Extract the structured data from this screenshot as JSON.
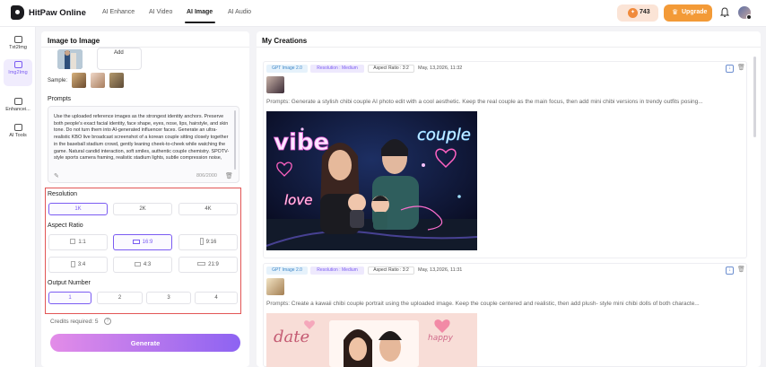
{
  "app": {
    "name": "HitPaw Online"
  },
  "nav": {
    "items": [
      "AI Enhance",
      "AI Video",
      "AI Image",
      "AI Audio"
    ],
    "active": "AI Image"
  },
  "header": {
    "credits": "743",
    "upgrade_label": "Upgrade"
  },
  "sidebar": {
    "items": [
      {
        "label": "Txt2Img",
        "icon": "text-image-icon"
      },
      {
        "label": "Img2Img",
        "icon": "image-image-icon",
        "active": true
      },
      {
        "label": "Enhancei...",
        "icon": "enhance-icon"
      },
      {
        "label": "AI Tools",
        "icon": "tools-icon"
      }
    ]
  },
  "left_panel": {
    "title": "Image to Image",
    "add_label": "Add",
    "sample_label": "Sample:",
    "prompts_label": "Prompts",
    "prompt_text": "Use the uploaded reference images as the strongest identity anchors. Preserve both people's exact facial identity, face shape, eyes, nose, lips, hairstyle, and skin tone. Do not turn them into AI-generated influencer faces. Generate an ultra-realistic KBO live broadcast screenshot of a korean couple sitting closely together in the baseball stadium crowd, gently leaning cheek-to-cheek while watching the game. Natural candid interaction, soft smiles, authentic couple chemistry. SPOTV-style sports camera framing, realistic stadium lights, subtle compression noise,",
    "char_count": "806/2000",
    "resolution": {
      "label": "Resolution",
      "options": [
        "1K",
        "2K",
        "4K"
      ],
      "selected": "1K"
    },
    "aspect_ratio": {
      "label": "Aspect Ratio",
      "options": [
        "1:1",
        "16:9",
        "9:16",
        "3:4",
        "4:3",
        "21:9"
      ],
      "selected": "16:9"
    },
    "output_number": {
      "label": "Output Number",
      "options": [
        "1",
        "2",
        "3",
        "4"
      ],
      "selected": "1"
    },
    "credits_required": "Credits required: 5",
    "generate_label": "Generate"
  },
  "main": {
    "title": "My Creations",
    "creations": [
      {
        "model": "GPT Image 2.0",
        "resolution": "Resolution : Medium",
        "aspect_ratio": "Aspect Ratio : 3:2",
        "date": "May, 13,2026, 11:32",
        "prompt": "Prompts: Generate a stylish chibi couple AI photo edit with a cool aesthetic. Keep the real couple as the main focus, then add mini chibi versions in trendy outfits posing..."
      },
      {
        "model": "GPT Image 2.0",
        "resolution": "Resolution : Medium",
        "aspect_ratio": "Aspect Ratio : 3:2",
        "date": "May, 13,2026, 11:31",
        "prompt": "Prompts: Create a kawaii chibi couple portrait using the uploaded image. Keep the couple centered and realistic, then add plush- style mini chibi dolls of both characte..."
      }
    ],
    "image1_words": [
      "vibe",
      "couple",
      "love"
    ],
    "image2_words": [
      "date",
      "happy"
    ]
  },
  "colors": {
    "accent": "#7b5cf2",
    "upgrade": "#f39a37",
    "highlight_box": "#e25555"
  }
}
